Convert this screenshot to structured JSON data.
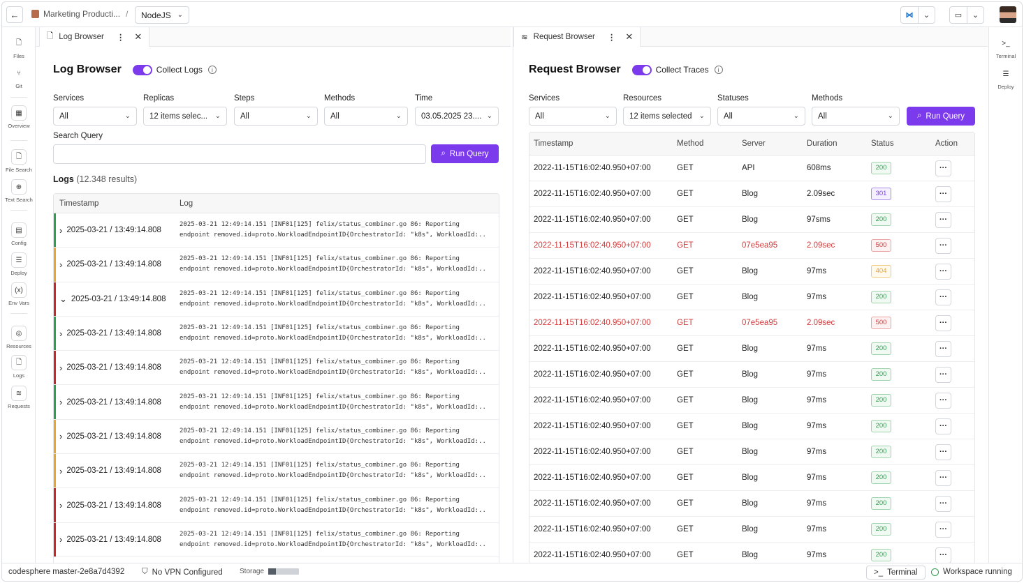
{
  "topbar": {
    "project": "Marketing Producti...",
    "separator": "/",
    "branch": "NodeJS"
  },
  "left_rail": [
    {
      "label": "Files",
      "icon": "file-icon",
      "glyph": "🗋"
    },
    {
      "label": "Git",
      "icon": "git-branch-icon",
      "glyph": "⑂"
    },
    {
      "label": "Overview",
      "icon": "grid-icon",
      "glyph": "▦"
    },
    {
      "label": "File Search",
      "icon": "file-search-icon",
      "glyph": "🗋"
    },
    {
      "label": "Text Search",
      "icon": "text-search-icon",
      "glyph": "⊕"
    },
    {
      "label": "Config",
      "icon": "config-icon",
      "glyph": "▤"
    },
    {
      "label": "Deploy",
      "icon": "deploy-icon",
      "glyph": "☰"
    },
    {
      "label": "Env Vars",
      "icon": "env-vars-icon",
      "glyph": "(x)"
    },
    {
      "label": "Resources",
      "icon": "resources-icon",
      "glyph": "◎"
    },
    {
      "label": "Logs",
      "icon": "logs-icon",
      "glyph": "🗋"
    },
    {
      "label": "Requests",
      "icon": "wifi-icon",
      "glyph": "≋"
    }
  ],
  "right_rail": [
    {
      "label": "Terminal",
      "icon": "terminal-icon",
      "glyph": ">_"
    },
    {
      "label": "Deploy",
      "icon": "deploy-icon",
      "glyph": "☰"
    }
  ],
  "log_browser": {
    "tab_label": "Log Browser",
    "title": "Log Browser",
    "toggle_label": "Collect Logs",
    "filters": [
      {
        "label": "Services",
        "value": "All"
      },
      {
        "label": "Replicas",
        "value": "12 items selec..."
      },
      {
        "label": "Steps",
        "value": "All"
      },
      {
        "label": "Methods",
        "value": "All"
      },
      {
        "label": "Time",
        "value": "03.05.2025 23...."
      }
    ],
    "search_label": "Search Query",
    "search_value": "",
    "run_label": "Run Query",
    "logs_title": "Logs",
    "logs_count": "(12.348 results)",
    "columns": [
      "Timestamp",
      "Log"
    ],
    "rows": [
      {
        "level": "success",
        "expanded": false,
        "ts": "2025-03-21 / 13:49:14.808",
        "line1": "2025-03-21 12:49:14.151 [INF01[125] felix/status_combiner.go 86: Reporting",
        "line2": "endpoint removed.id=proto.WorkloadEndpointID{OrchestratorId: \"k8s\", WorkloadId:.."
      },
      {
        "level": "warning",
        "expanded": false,
        "ts": "2025-03-21 / 13:49:14.808",
        "line1": "2025-03-21 12:49:14.151 [INF01[125] felix/status_combiner.go 86: Reporting",
        "line2": "endpoint removed.id=proto.WorkloadEndpointID{OrchestratorId: \"k8s\", WorkloadId:.."
      },
      {
        "level": "error",
        "expanded": true,
        "ts": "2025-03-21 / 13:49:14.808",
        "line1": "2025-03-21 12:49:14.151 [INF01[125] felix/status_combiner.go 86: Reporting",
        "line2": "endpoint removed.id=proto.WorkloadEndpointID{OrchestratorId: \"k8s\", WorkloadId:.."
      },
      {
        "level": "success",
        "expanded": false,
        "ts": "2025-03-21 / 13:49:14.808",
        "line1": "2025-03-21 12:49:14.151 [INF01[125] felix/status_combiner.go 86: Reporting",
        "line2": "endpoint removed.id=proto.WorkloadEndpointID{OrchestratorId: \"k8s\", WorkloadId:.."
      },
      {
        "level": "error",
        "expanded": false,
        "ts": "2025-03-21 / 13:49:14.808",
        "line1": "2025-03-21 12:49:14.151 [INF01[125] felix/status_combiner.go 86: Reporting",
        "line2": "endpoint removed.id=proto.WorkloadEndpointID{OrchestratorId: \"k8s\", WorkloadId:.."
      },
      {
        "level": "success",
        "expanded": false,
        "ts": "2025-03-21 / 13:49:14.808",
        "line1": "2025-03-21 12:49:14.151 [INF01[125] felix/status_combiner.go 86: Reporting",
        "line2": "endpoint removed.id=proto.WorkloadEndpointID{OrchestratorId: \"k8s\", WorkloadId:.."
      },
      {
        "level": "warning",
        "expanded": false,
        "ts": "2025-03-21 / 13:49:14.808",
        "line1": "2025-03-21 12:49:14.151 [INF01[125] felix/status_combiner.go 86: Reporting",
        "line2": "endpoint removed.id=proto.WorkloadEndpointID{OrchestratorId: \"k8s\", WorkloadId:.."
      },
      {
        "level": "warning",
        "expanded": false,
        "ts": "2025-03-21 / 13:49:14.808",
        "line1": "2025-03-21 12:49:14.151 [INF01[125] felix/status_combiner.go 86: Reporting",
        "line2": "endpoint removed.id=proto.WorkloadEndpointID{OrchestratorId: \"k8s\", WorkloadId:.."
      },
      {
        "level": "error",
        "expanded": false,
        "ts": "2025-03-21 / 13:49:14.808",
        "line1": "2025-03-21 12:49:14.151 [INF01[125] felix/status_combiner.go 86: Reporting",
        "line2": "endpoint removed.id=proto.WorkloadEndpointID{OrchestratorId: \"k8s\", WorkloadId:.."
      },
      {
        "level": "error",
        "expanded": false,
        "ts": "2025-03-21 / 13:49:14.808",
        "line1": "2025-03-21 12:49:14.151 [INF01[125] felix/status_combiner.go 86: Reporting",
        "line2": "endpoint removed.id=proto.WorkloadEndpointID{OrchestratorId: \"k8s\", WorkloadId:.."
      }
    ]
  },
  "request_browser": {
    "tab_label": "Request Browser",
    "title": "Request Browser",
    "toggle_label": "Collect Traces",
    "filters": [
      {
        "label": "Services",
        "value": "All"
      },
      {
        "label": "Resources",
        "value": "12 items selected"
      },
      {
        "label": "Statuses",
        "value": "All"
      },
      {
        "label": "Methods",
        "value": "All"
      }
    ],
    "run_label": "Run Query",
    "columns": [
      "Timestamp",
      "Method",
      "Server",
      "Duration",
      "Status",
      "Action"
    ],
    "rows": [
      {
        "ts": "2022-11-15T16:02:40.950+07:00",
        "method": "GET",
        "server": "API",
        "duration": "608ms",
        "status": "200",
        "error": false
      },
      {
        "ts": "2022-11-15T16:02:40.950+07:00",
        "method": "GET",
        "server": "Blog",
        "duration": "2.09sec",
        "status": "301",
        "error": false
      },
      {
        "ts": "2022-11-15T16:02:40.950+07:00",
        "method": "GET",
        "server": "Blog",
        "duration": "97sms",
        "status": "200",
        "error": false
      },
      {
        "ts": "2022-11-15T16:02:40.950+07:00",
        "method": "GET",
        "server": "07e5ea95",
        "duration": "2.09sec",
        "status": "500",
        "error": true
      },
      {
        "ts": "2022-11-15T16:02:40.950+07:00",
        "method": "GET",
        "server": "Blog",
        "duration": "97ms",
        "status": "404",
        "error": false
      },
      {
        "ts": "2022-11-15T16:02:40.950+07:00",
        "method": "GET",
        "server": "Blog",
        "duration": "97ms",
        "status": "200",
        "error": false
      },
      {
        "ts": "2022-11-15T16:02:40.950+07:00",
        "method": "GET",
        "server": "07e5ea95",
        "duration": "2.09sec",
        "status": "500",
        "error": true
      },
      {
        "ts": "2022-11-15T16:02:40.950+07:00",
        "method": "GET",
        "server": "Blog",
        "duration": "97ms",
        "status": "200",
        "error": false
      },
      {
        "ts": "2022-11-15T16:02:40.950+07:00",
        "method": "GET",
        "server": "Blog",
        "duration": "97ms",
        "status": "200",
        "error": false
      },
      {
        "ts": "2022-11-15T16:02:40.950+07:00",
        "method": "GET",
        "server": "Blog",
        "duration": "97ms",
        "status": "200",
        "error": false
      },
      {
        "ts": "2022-11-15T16:02:40.950+07:00",
        "method": "GET",
        "server": "Blog",
        "duration": "97ms",
        "status": "200",
        "error": false
      },
      {
        "ts": "2022-11-15T16:02:40.950+07:00",
        "method": "GET",
        "server": "Blog",
        "duration": "97ms",
        "status": "200",
        "error": false
      },
      {
        "ts": "2022-11-15T16:02:40.950+07:00",
        "method": "GET",
        "server": "Blog",
        "duration": "97ms",
        "status": "200",
        "error": false
      },
      {
        "ts": "2022-11-15T16:02:40.950+07:00",
        "method": "GET",
        "server": "Blog",
        "duration": "97ms",
        "status": "200",
        "error": false
      },
      {
        "ts": "2022-11-15T16:02:40.950+07:00",
        "method": "GET",
        "server": "Blog",
        "duration": "97ms",
        "status": "200",
        "error": false
      },
      {
        "ts": "2022-11-15T16:02:40.950+07:00",
        "method": "GET",
        "server": "Blog",
        "duration": "97ms",
        "status": "200",
        "error": false
      }
    ]
  },
  "statusbar": {
    "branch": "codesphere master-2e8a7d4392",
    "vpn": "No VPN Configured",
    "storage_label": "Storage",
    "storage_fraction": 0.25,
    "terminal": "Terminal",
    "workspace": "Workspace running"
  },
  "colors": {
    "accent": "#7c3aed",
    "success": "#2e9e4f",
    "warning": "#e8a530",
    "error": "#c62828",
    "error_text": "#d13b3b",
    "badge_301": "#7c3aed",
    "badge_404": "#e8a530"
  }
}
